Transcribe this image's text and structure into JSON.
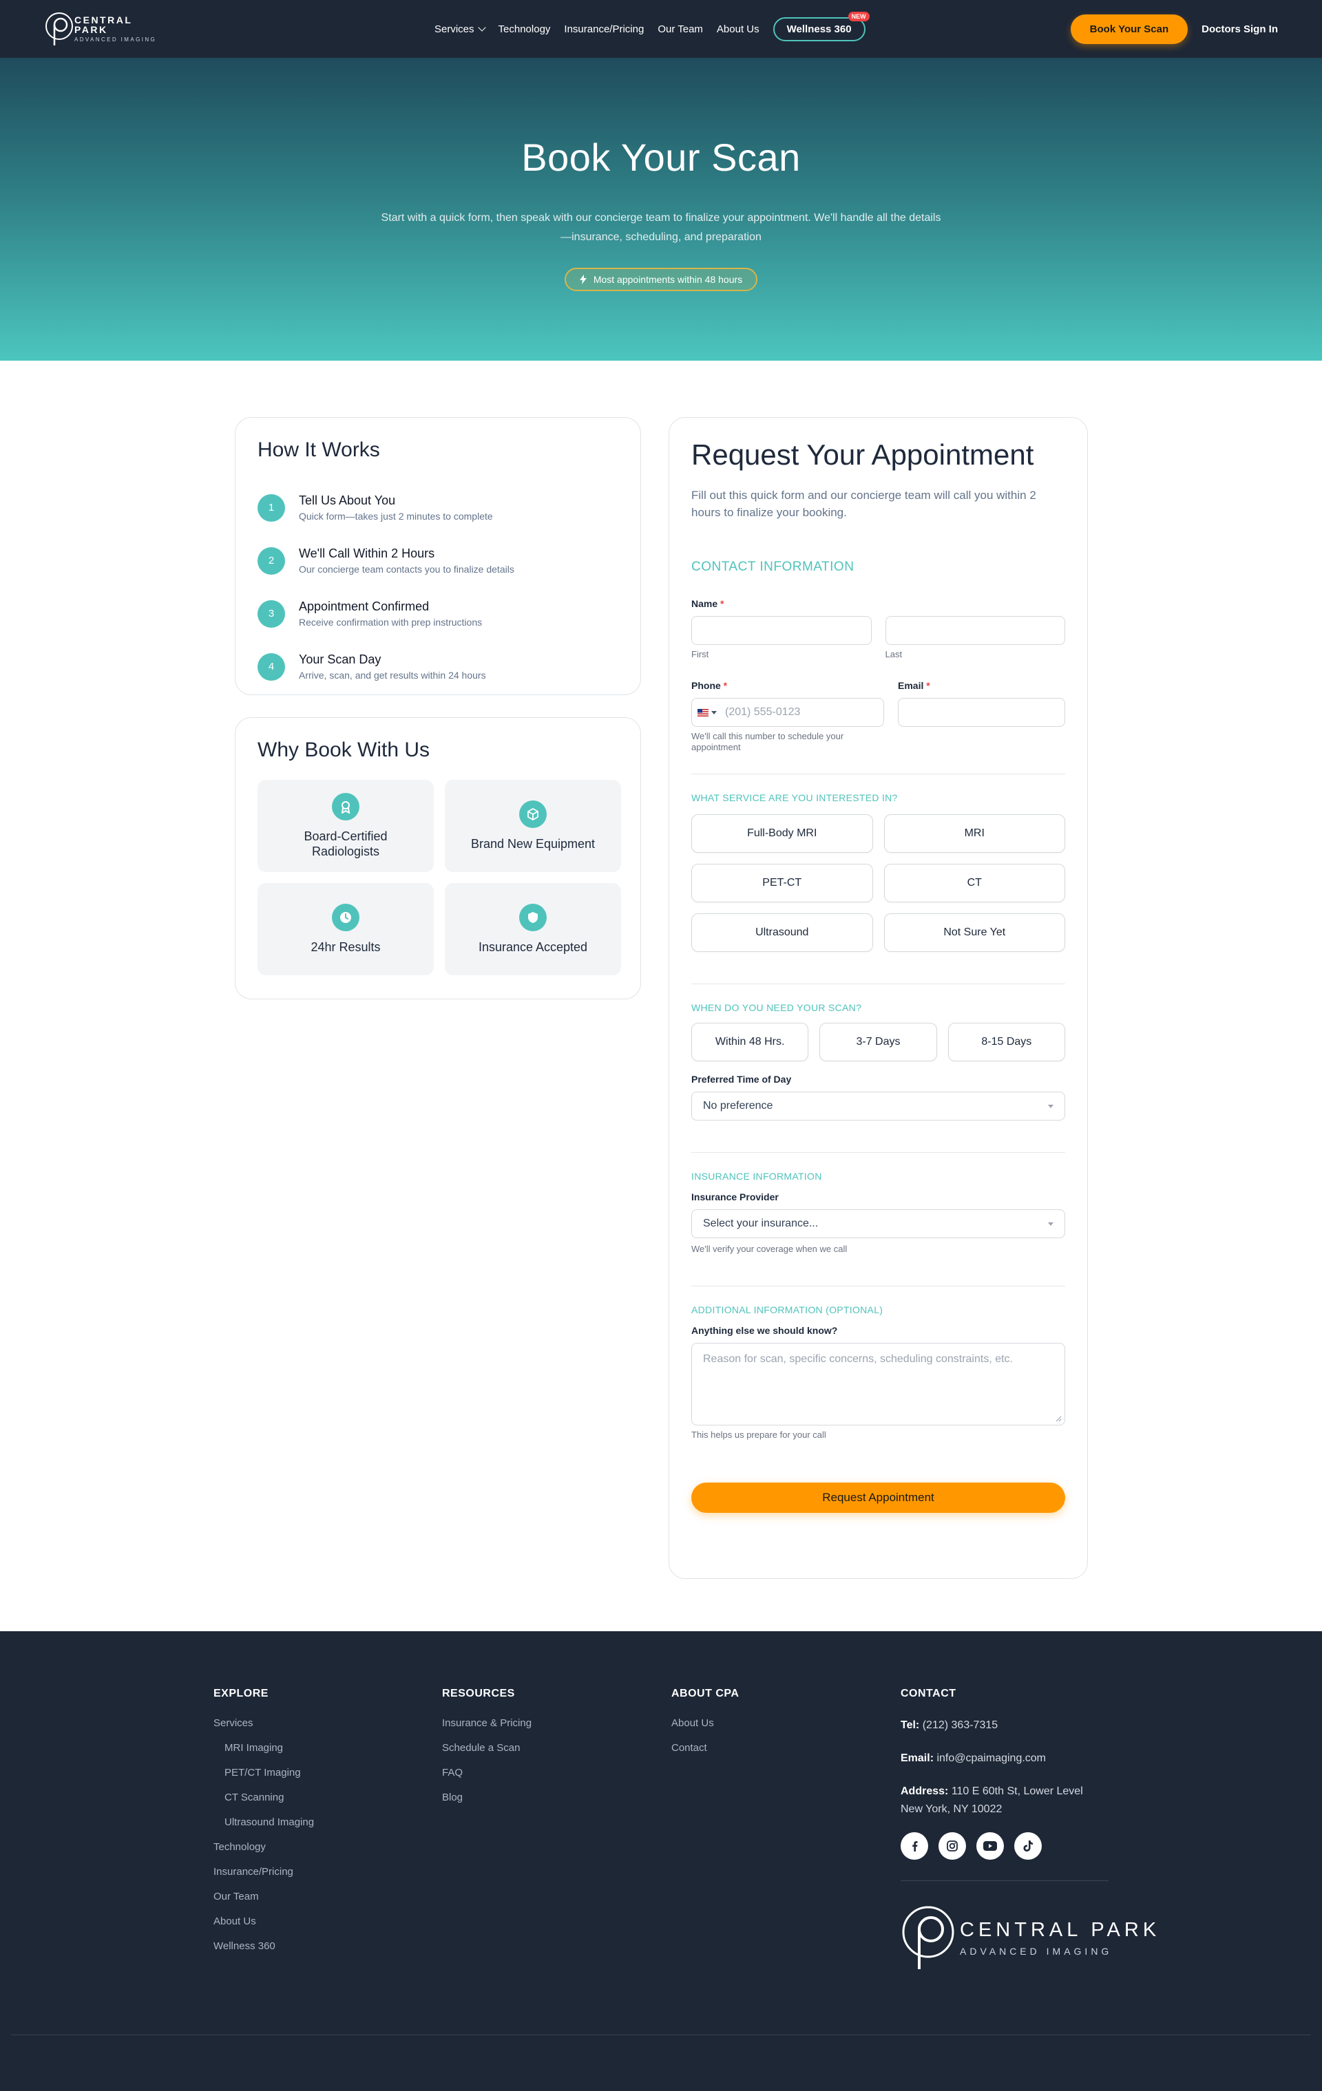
{
  "nav": {
    "logo_line1": "CENTRAL PARK",
    "logo_line2": "ADVANCED IMAGING",
    "links": [
      "Services",
      "Technology",
      "Insurance/Pricing",
      "Our Team",
      "About Us"
    ],
    "wellness": "Wellness 360",
    "wellness_badge": "NEW",
    "book_button": "Book Your Scan",
    "doctors": "Doctors Sign In"
  },
  "hero": {
    "title": "Book Your Scan",
    "subtitle": "Start with a quick form, then speak with our concierge team to finalize your appointment. We'll handle all the details—insurance, scheduling, and preparation",
    "badge": "Most appointments within 48 hours"
  },
  "how_it_works": {
    "title": "How It Works",
    "steps": [
      {
        "num": "1",
        "title": "Tell Us About You",
        "desc": "Quick form—takes just 2 minutes to complete"
      },
      {
        "num": "2",
        "title": "We'll Call Within 2 Hours",
        "desc": "Our concierge team contacts you to finalize details"
      },
      {
        "num": "3",
        "title": "Appointment Confirmed",
        "desc": "Receive confirmation with prep instructions"
      },
      {
        "num": "4",
        "title": "Your Scan Day",
        "desc": "Arrive, scan, and get results within 24 hours"
      }
    ]
  },
  "why": {
    "title": "Why Book With Us",
    "items": [
      {
        "label": "Board-Certified Radiologists",
        "icon": "award-icon"
      },
      {
        "label": "Brand New Equipment",
        "icon": "cube-icon"
      },
      {
        "label": "24hr Results",
        "icon": "clock-icon"
      },
      {
        "label": "Insurance Accepted",
        "icon": "shield-icon"
      }
    ]
  },
  "form": {
    "title": "Request Your Appointment",
    "intro": "Fill out this quick form and our concierge team will call you within 2 hours to finalize your booking.",
    "contact_heading": "CONTACT INFORMATION",
    "name_label": "Name",
    "required_mark": "*",
    "first_sub": "First",
    "last_sub": "Last",
    "phone_label": "Phone",
    "phone_placeholder": "(201) 555-0123",
    "phone_help": "We'll call this number to schedule your appointment",
    "email_label": "Email",
    "service_heading": "WHAT SERVICE ARE YOU INTERESTED IN?",
    "services": [
      "Full-Body MRI",
      "MRI",
      "PET-CT",
      "CT",
      "Ultrasound",
      "Not Sure Yet"
    ],
    "when_heading": "WHEN DO YOU NEED YOUR SCAN?",
    "when_options": [
      "Within 48 Hrs.",
      "3-7 Days",
      "8-15 Days"
    ],
    "time_label": "Preferred Time of Day",
    "time_value": "No preference",
    "insurance_heading": "INSURANCE INFORMATION",
    "insurance_label": "Insurance Provider",
    "insurance_value": "Select your insurance...",
    "insurance_help": "We'll verify your coverage when we call",
    "additional_heading": "ADDITIONAL INFORMATION (OPTIONAL)",
    "additional_label": "Anything else we should know?",
    "additional_placeholder": "Reason for scan, specific concerns, scheduling constraints, etc.",
    "additional_help": "This helps us prepare for your call",
    "submit": "Request Appointment"
  },
  "footer": {
    "explore_heading": "EXPLORE",
    "explore": [
      {
        "label": "Services",
        "indent": false
      },
      {
        "label": "MRI Imaging",
        "indent": true
      },
      {
        "label": "PET/CT Imaging",
        "indent": true
      },
      {
        "label": "CT Scanning",
        "indent": true
      },
      {
        "label": "Ultrasound Imaging",
        "indent": true
      },
      {
        "label": "Technology",
        "indent": false
      },
      {
        "label": "Insurance/Pricing",
        "indent": false
      },
      {
        "label": "Our Team",
        "indent": false
      },
      {
        "label": "About Us",
        "indent": false
      },
      {
        "label": "Wellness 360",
        "indent": false
      }
    ],
    "resources_heading": "RESOURCES",
    "resources": [
      "Insurance & Pricing",
      "Schedule a Scan",
      "FAQ",
      "Blog"
    ],
    "about_heading": "ABOUT CPA",
    "about": [
      "About Us",
      "Contact"
    ],
    "contact_heading": "CONTACT",
    "tel_label": "Tel:",
    "tel": "(212) 363-7315",
    "email_label": "Email:",
    "email": "info@cpaimaging.com",
    "address_label": "Address:",
    "address1": "110 E 60th St, Lower Level",
    "address2": "New York, NY 10022",
    "logo_line1": "CENTRAL PARK",
    "logo_line2": "ADVANCED IMAGING"
  },
  "colors": {
    "teal": "#4fc3bb",
    "orange": "#ff9800",
    "navy": "#1e2736"
  }
}
